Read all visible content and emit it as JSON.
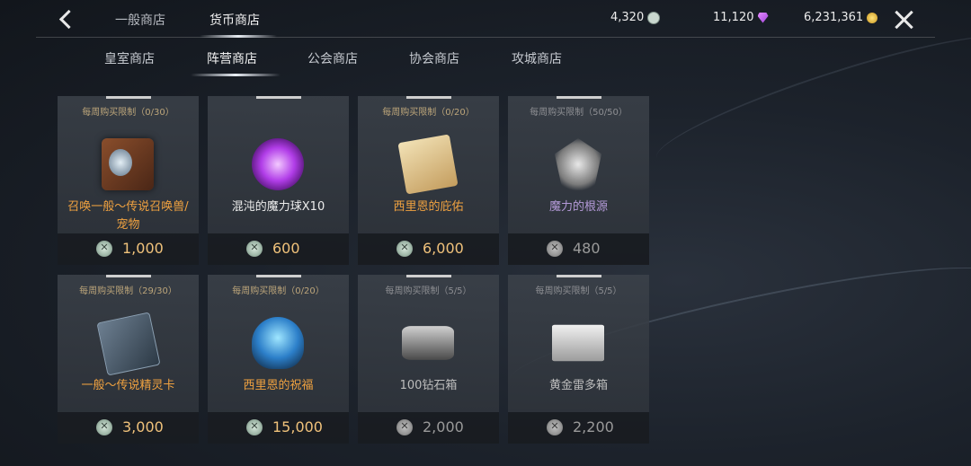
{
  "header": {
    "tabs": [
      {
        "label": "一般商店"
      },
      {
        "label": "货币商店"
      }
    ],
    "currencies": [
      {
        "icon": "silver-coin-icon",
        "amount": "4,320"
      },
      {
        "icon": "purple-gem-icon",
        "amount": "11,120"
      },
      {
        "icon": "gold-coin-icon",
        "amount": "6,231,361"
      }
    ]
  },
  "subtabs": [
    {
      "label": "皇室商店"
    },
    {
      "label": "阵营商店"
    },
    {
      "label": "公会商店"
    },
    {
      "label": "协会商店"
    },
    {
      "label": "攻城商店"
    }
  ],
  "items": [
    {
      "limit": "每周购买限制（0/30）",
      "name": "召唤一般～传说召唤兽/宠物",
      "price": "1,000",
      "icon": "summon-chest-icon"
    },
    {
      "limit": "",
      "name": "混沌的魔力球X10",
      "price": "600",
      "icon": "chaos-orb-icon"
    },
    {
      "limit": "每周购买限制（0/20）",
      "name": "西里恩的庇佑",
      "price": "6,000",
      "icon": "blessing-scroll-icon"
    },
    {
      "limit": "每周购买限制（50/50）",
      "name": "魔力的根源",
      "price": "480",
      "icon": "mana-essence-icon"
    },
    {
      "limit": "每周购买限制（29/30）",
      "name": "一般～传说精灵卡",
      "price": "3,000",
      "icon": "spirit-card-icon"
    },
    {
      "limit": "每周购买限制（0/20）",
      "name": "西里恩的祝福",
      "price": "15,000",
      "icon": "blessing-orb-icon"
    },
    {
      "limit": "每周购买限制（5/5）",
      "name": "100钻石箱",
      "price": "2,000",
      "icon": "diamond-box-icon"
    },
    {
      "limit": "每周购买限制（5/5）",
      "name": "黄金雷多箱",
      "price": "2,200",
      "icon": "gold-chest-icon"
    }
  ]
}
